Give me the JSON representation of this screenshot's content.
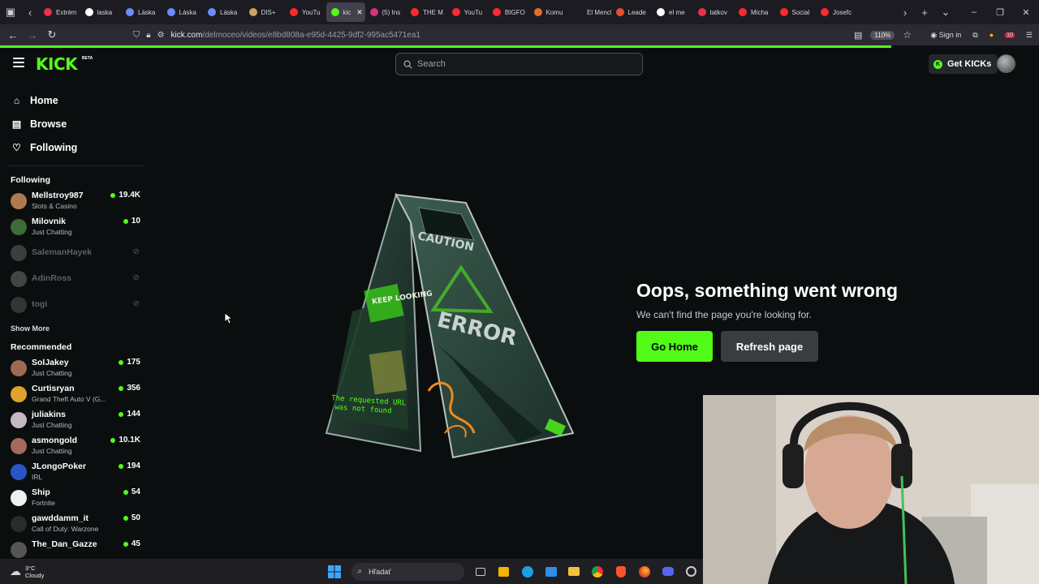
{
  "browser": {
    "tabs": [
      {
        "label": "Extrém",
        "color": "#e8324b"
      },
      {
        "label": "laska",
        "color": "#ffffff"
      },
      {
        "label": "Láska",
        "color": "#6a8cff"
      },
      {
        "label": "Láska",
        "color": "#6a8cff"
      },
      {
        "label": "Láska",
        "color": "#6a8cff"
      },
      {
        "label": "DIS+",
        "color": "#caa45a"
      },
      {
        "label": "YouTu",
        "color": "#ff2b2b"
      },
      {
        "label": "kic",
        "color": "#53fc18",
        "active": true
      },
      {
        "label": "(5) Ins",
        "color": "#d6317b"
      },
      {
        "label": "THE M",
        "color": "#ff2b2b"
      },
      {
        "label": "YouTu",
        "color": "#ff2b2b"
      },
      {
        "label": "BIGFO",
        "color": "#ff2b2b"
      },
      {
        "label": "Komu",
        "color": "#e66b2c"
      },
      {
        "label": "El Menchc",
        "color": "#1c1b22"
      },
      {
        "label": "Leade",
        "color": "#e6502c"
      },
      {
        "label": "el me",
        "color": "#ffffff"
      },
      {
        "label": "tatkov",
        "color": "#e8324b"
      },
      {
        "label": "Micha",
        "color": "#ff2b2b"
      },
      {
        "label": "Social",
        "color": "#ff2b2b"
      },
      {
        "label": "Josefc",
        "color": "#ff2b2b"
      }
    ],
    "url_host": "kick.com",
    "url_path": "/delmoceo/videos/e8bd808a-e95d-4425-9df2-995ac5471ea1",
    "zoom": "110%",
    "sign_in": "Sign in",
    "badge_count": "10",
    "load_progress": 0.858
  },
  "header": {
    "logo": "KICK",
    "logo_badge": "BETA",
    "search_placeholder": "Search",
    "get_kicks": "Get KICKs"
  },
  "sidebar": {
    "nav": [
      {
        "label": "Home",
        "icon": "home-icon"
      },
      {
        "label": "Browse",
        "icon": "browse-icon"
      },
      {
        "label": "Following",
        "icon": "heart-icon"
      }
    ],
    "following_title": "Following",
    "following": [
      {
        "name": "Mellstroy987",
        "category": "Slots & Casino",
        "viewers": "19.4K",
        "live": true,
        "avatar": "#b07a4f"
      },
      {
        "name": "Milovnik",
        "category": "Just Chatting",
        "viewers": "10",
        "live": true,
        "avatar": "#3d6b3a"
      },
      {
        "name": "SalemanHayek",
        "live": false,
        "avatar": "#777777"
      },
      {
        "name": "AdinRoss",
        "live": false,
        "avatar": "#888888"
      },
      {
        "name": "togi",
        "live": false,
        "avatar": "#666666"
      }
    ],
    "show_more": "Show More",
    "recommended_title": "Recommended",
    "recommended": [
      {
        "name": "SolJakey",
        "category": "Just Chatting",
        "viewers": "175",
        "avatar": "#9c6b52"
      },
      {
        "name": "Curtisryan",
        "category": "Grand Theft Auto V (G...",
        "viewers": "356",
        "avatar": "#e0a22c"
      },
      {
        "name": "juliakins",
        "category": "Just Chatting",
        "viewers": "144",
        "avatar": "#c7b7c4"
      },
      {
        "name": "asmongold",
        "category": "Just Chatting",
        "viewers": "10.1K",
        "avatar": "#a36a5d"
      },
      {
        "name": "JLongoPoker",
        "category": "IRL",
        "viewers": "194",
        "avatar": "#2a55c8"
      },
      {
        "name": "Ship",
        "category": "Fortnite",
        "viewers": "54",
        "avatar": "#f0f0f0"
      },
      {
        "name": "gawddamm_it",
        "category": "Call of Duty: Warzone",
        "viewers": "50",
        "avatar": "#2b2b2b"
      },
      {
        "name": "The_Dan_Gazze",
        "category": "",
        "viewers": "45",
        "avatar": "#555555"
      }
    ]
  },
  "error": {
    "title": "Oops, something went wrong",
    "subtitle": "We can't find the page you're looking for.",
    "go_home": "Go Home",
    "refresh": "Refresh page",
    "sign_caution": "CAUTION",
    "sign_error": "ERROR",
    "sign_keep": "KEEP LOOKING",
    "sign_msg1": "The requested URL",
    "sign_msg2": "was not found"
  },
  "taskbar": {
    "temp": "3°C",
    "weather": "Cloudy",
    "search": "Hľadať"
  },
  "colors": {
    "accent": "#53fc18",
    "background": "#0b0e0f"
  }
}
